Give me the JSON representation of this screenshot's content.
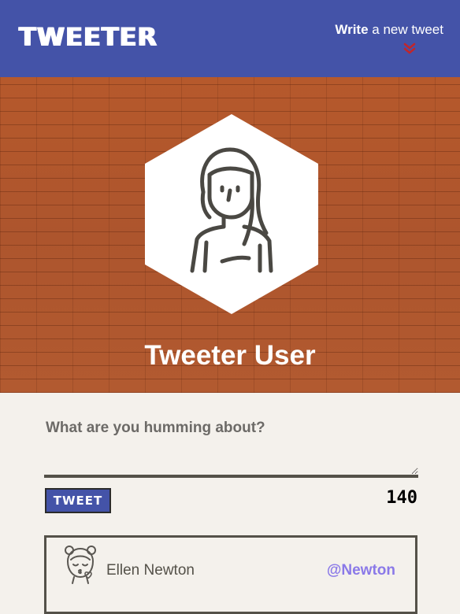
{
  "nav": {
    "brand": "TWEETER",
    "compose_bold": "Write",
    "compose_rest": " a new tweet",
    "chevron_icon": "double-chevron-down-icon",
    "chevron_color": "#c0262c",
    "background_color": "#4453a8"
  },
  "header": {
    "user_name": "Tweeter User",
    "avatar_icon": "woman-avatar-icon",
    "background": "brick-wall"
  },
  "compose": {
    "label": "What are you humming about?",
    "input_value": "",
    "button_label": "TWEET",
    "char_counter": "140"
  },
  "tweets": [
    {
      "avatar_icon": "girl-kiss-avatar-icon",
      "name": "Ellen Newton",
      "handle": "@Newton",
      "handle_color": "#8a79e8"
    }
  ]
}
